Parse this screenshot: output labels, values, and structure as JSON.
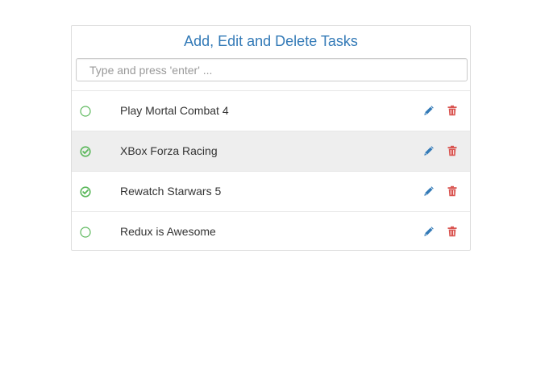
{
  "header": {
    "title": "Add, Edit and Delete Tasks"
  },
  "input": {
    "placeholder": "Type and press 'enter' ...",
    "value": ""
  },
  "colors": {
    "title": "#337ab7",
    "check_green": "#5cb85c",
    "edit_blue": "#337ab7",
    "delete_red": "#d9534f",
    "highlight_row": "#eeeeee"
  },
  "tasks": [
    {
      "label": "Play Mortal Combat 4",
      "completed": false,
      "status_icon": "circle-outline-icon"
    },
    {
      "label": "XBox Forza Racing",
      "completed": true,
      "status_icon": "check-circle-icon"
    },
    {
      "label": "Rewatch Starwars 5",
      "completed": true,
      "status_icon": "check-circle-icon"
    },
    {
      "label": "Redux is Awesome",
      "completed": false,
      "status_icon": "circle-outline-icon"
    }
  ]
}
